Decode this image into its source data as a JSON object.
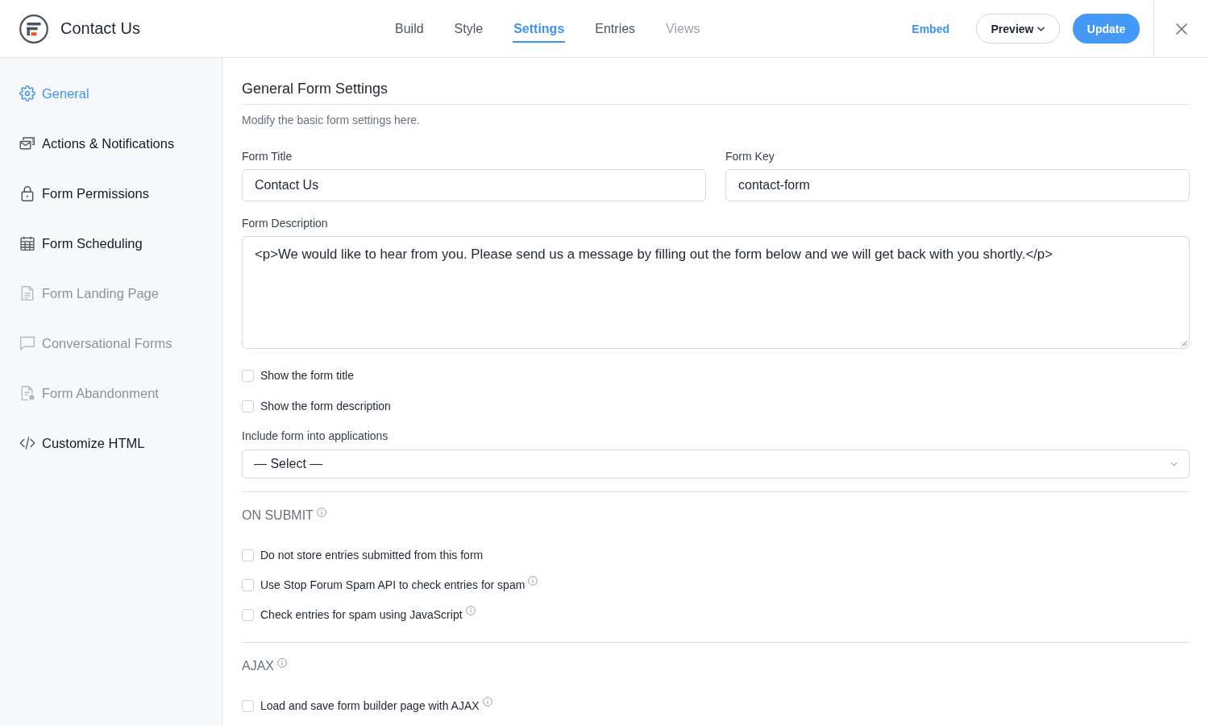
{
  "header": {
    "title": "Contact Us",
    "tabs": [
      {
        "label": "Build",
        "selected": false,
        "disabled": false
      },
      {
        "label": "Style",
        "selected": false,
        "disabled": false
      },
      {
        "label": "Settings",
        "selected": true,
        "disabled": false
      },
      {
        "label": "Entries",
        "selected": false,
        "disabled": false
      },
      {
        "label": "Views",
        "selected": false,
        "disabled": true
      }
    ],
    "embed": "Embed",
    "preview": "Preview",
    "update": "Update"
  },
  "sidebar": {
    "items": [
      {
        "label": "General",
        "kind": "gear",
        "selected": true,
        "disabled": false
      },
      {
        "label": "Actions & Notifications",
        "kind": "mail",
        "selected": false,
        "disabled": false
      },
      {
        "label": "Form Permissions",
        "kind": "lock",
        "selected": false,
        "disabled": false
      },
      {
        "label": "Form Scheduling",
        "kind": "calendar",
        "selected": false,
        "disabled": false
      },
      {
        "label": "Form Landing Page",
        "kind": "document",
        "selected": false,
        "disabled": true
      },
      {
        "label": "Conversational Forms",
        "kind": "chat",
        "selected": false,
        "disabled": true
      },
      {
        "label": "Form Abandonment",
        "kind": "docbadge",
        "selected": false,
        "disabled": true
      },
      {
        "label": "Customize HTML",
        "kind": "code",
        "selected": false,
        "disabled": false
      }
    ]
  },
  "settings": {
    "title": "General Form Settings",
    "subtitle": "Modify the basic form settings here.",
    "form_title": {
      "label": "Form Title",
      "value": "Contact Us"
    },
    "form_key": {
      "label": "Form Key",
      "value": "contact-form"
    },
    "form_description": {
      "label": "Form Description",
      "value": "<p>We would like to hear from you. Please send us a message by filling out the form below and we will get back with you shortly.</p>"
    },
    "display_options": [
      {
        "label": "Show the form title",
        "checked": false,
        "info": false
      },
      {
        "label": "Show the form description",
        "checked": false,
        "info": false
      }
    ],
    "applications": {
      "label": "Include form into applications",
      "value": "— Select —"
    }
  },
  "on_submit": {
    "heading": "ON SUBMIT",
    "info": true,
    "options": [
      {
        "label": "Do not store entries submitted from this form",
        "checked": false,
        "info": false
      },
      {
        "label": "Use Stop Forum Spam API to check entries for spam",
        "checked": false,
        "info": true
      },
      {
        "label": "Check entries for spam using JavaScript",
        "checked": false,
        "info": true
      }
    ]
  },
  "ajax": {
    "heading": "AJAX",
    "info": true,
    "options": [
      {
        "label": "Load and save form builder page with AJAX",
        "checked": false,
        "info": true
      }
    ]
  }
}
